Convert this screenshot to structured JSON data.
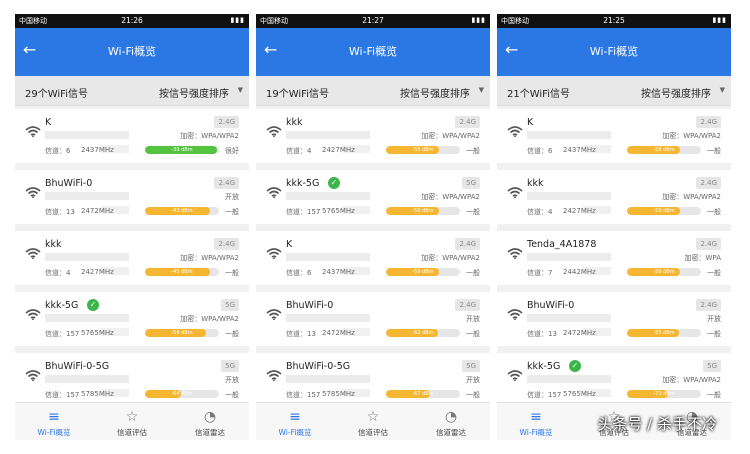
{
  "colors": {
    "accent": "#2b78e4",
    "good": "#54c340",
    "fair": "#f5b731",
    "check": "#3cb54a"
  },
  "screens": [
    {
      "status": {
        "carrier": "中国移动",
        "time": "21:26"
      },
      "appbar": {
        "title": "Wi-Fi概览"
      },
      "filter": {
        "count": "29个WiFi信号",
        "sort": "按信号强度排序"
      },
      "networks": [
        {
          "name": "K",
          "connected": false,
          "band": "2.4G",
          "encryption": "加密：WPA/WPA2",
          "channel": "信道：6",
          "frequency": "2437MHz",
          "dbm": "-39 dBm",
          "level": 0.97,
          "quality": "很好",
          "tier": "good"
        },
        {
          "name": "BhuWiFi-0",
          "connected": false,
          "band": "2.4G",
          "encryption": "开放",
          "channel": "信道：13",
          "frequency": "2472MHz",
          "dbm": "-43 dBm",
          "level": 0.88,
          "quality": "一般",
          "tier": "fair"
        },
        {
          "name": "kkk",
          "connected": false,
          "band": "2.4G",
          "encryption": "加密：WPA/WPA2",
          "channel": "信道：4",
          "frequency": "2427MHz",
          "dbm": "-45 dBm",
          "level": 0.88,
          "quality": "一般",
          "tier": "fair"
        },
        {
          "name": "kkk-5G",
          "connected": true,
          "band": "5G",
          "encryption": "加密：WPA/WPA2",
          "channel": "信道：157",
          "frequency": "5765MHz",
          "dbm": "-54 dBm",
          "level": 0.83,
          "quality": "一般",
          "tier": "fair"
        },
        {
          "name": "BhuWiFi-0-5G",
          "connected": false,
          "band": "5G",
          "encryption": "开放",
          "channel": "信道：157",
          "frequency": "5785MHz",
          "dbm": "-64 dBm",
          "level": 0.49,
          "quality": "一般",
          "tier": "fair"
        }
      ],
      "nav": [
        "Wi-Fi概览",
        "信道评估",
        "信道雷达"
      ]
    },
    {
      "status": {
        "carrier": "中国移动",
        "time": "21:27"
      },
      "appbar": {
        "title": "Wi-Fi概览"
      },
      "filter": {
        "count": "19个WiFi信号",
        "sort": "按信号强度排序"
      },
      "networks": [
        {
          "name": "kkk",
          "connected": false,
          "band": "2.4G",
          "encryption": "加密：WPA/WPA2",
          "channel": "信道：4",
          "frequency": "2427MHz",
          "dbm": "-55 dBm",
          "level": 0.72,
          "quality": "一般",
          "tier": "fair"
        },
        {
          "name": "kkk-5G",
          "connected": true,
          "band": "5G",
          "encryption": "加密：WPA/WPA2",
          "channel": "信道：157",
          "frequency": "5765MHz",
          "dbm": "-56 dBm",
          "level": 0.72,
          "quality": "一般",
          "tier": "fair"
        },
        {
          "name": "K",
          "connected": false,
          "band": "2.4G",
          "encryption": "加密：WPA/WPA2",
          "channel": "信道：6",
          "frequency": "2437MHz",
          "dbm": "-59 dBm",
          "level": 0.72,
          "quality": "一般",
          "tier": "fair"
        },
        {
          "name": "BhuWiFi-0",
          "connected": false,
          "band": "2.4G",
          "encryption": "开放",
          "channel": "信道：13",
          "frequency": "2472MHz",
          "dbm": "-62 dBm",
          "level": 0.7,
          "quality": "一般",
          "tier": "fair"
        },
        {
          "name": "BhuWiFi-0-5G",
          "connected": false,
          "band": "5G",
          "encryption": "开放",
          "channel": "信道：157",
          "frequency": "5785MHz",
          "dbm": "-67 dBm",
          "level": 0.59,
          "quality": "一般",
          "tier": "fair"
        }
      ],
      "nav": [
        "Wi-Fi概览",
        "信道评估",
        "信道雷达"
      ]
    },
    {
      "status": {
        "carrier": "中国移动",
        "time": "21:25"
      },
      "appbar": {
        "title": "Wi-Fi概览"
      },
      "filter": {
        "count": "21个WiFi信号",
        "sort": "按信号强度排序"
      },
      "networks": [
        {
          "name": "K",
          "connected": false,
          "band": "2.4G",
          "encryption": "加密：WPA/WPA2",
          "channel": "信道：6",
          "frequency": "2437MHz",
          "dbm": "-58 dBm",
          "level": 0.72,
          "quality": "一般",
          "tier": "fair"
        },
        {
          "name": "kkk",
          "connected": false,
          "band": "2.4G",
          "encryption": "加密：WPA/WPA2",
          "channel": "信道：4",
          "frequency": "2427MHz",
          "dbm": "-59 dBm",
          "level": 0.72,
          "quality": "一般",
          "tier": "fair"
        },
        {
          "name": "Tenda_4A1878",
          "connected": false,
          "band": "2.4G",
          "encryption": "加密：WPA",
          "channel": "信道：7",
          "frequency": "2442MHz",
          "dbm": "-59 dBm",
          "level": 0.72,
          "quality": "一般",
          "tier": "fair"
        },
        {
          "name": "BhuWiFi-0",
          "connected": false,
          "band": "2.4G",
          "encryption": "开放",
          "channel": "信道：13",
          "frequency": "2472MHz",
          "dbm": "-65 dBm",
          "level": 0.7,
          "quality": "一般",
          "tier": "fair"
        },
        {
          "name": "kkk-5G",
          "connected": true,
          "band": "5G",
          "encryption": "加密：WPA/WPA2",
          "channel": "信道：157",
          "frequency": "5765MHz",
          "dbm": "-73 dBm",
          "level": 0.55,
          "quality": "一般",
          "tier": "fair"
        }
      ],
      "nav": [
        "Wi-Fi概览",
        "信道评估",
        "信道雷达"
      ]
    }
  ],
  "watermark": "头条号 / 杀手不冷"
}
